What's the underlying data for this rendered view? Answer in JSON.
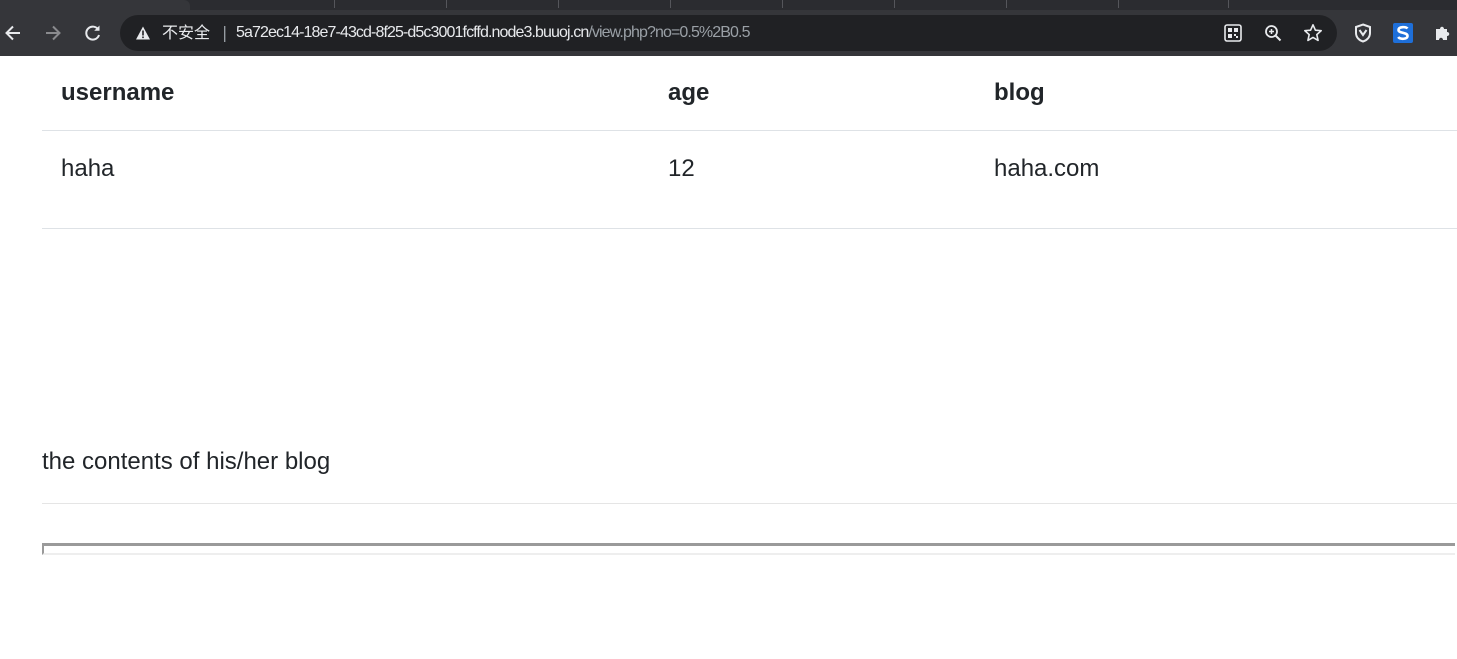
{
  "browser": {
    "address_bar": {
      "security_label": "不安全",
      "separator": "|",
      "url_host": "5a72ec14-18e7-43cd-8f25-d5c3001fcffd.node3.buuoj.cn",
      "url_path": "/view.php?no=0.5%2B0.5"
    },
    "icons": {
      "back": "back-arrow-icon",
      "forward": "forward-arrow-icon",
      "reload": "reload-icon",
      "warning": "warning-triangle-icon",
      "qr": "qr-code-icon",
      "zoom": "zoom-icon",
      "bookmark": "star-icon",
      "extension_shield": "shield-extension-icon",
      "extension_s": "s-extension-icon",
      "extensions": "puzzle-icon"
    }
  },
  "table": {
    "headers": [
      "username",
      "age",
      "blog"
    ],
    "rows": [
      [
        "haha",
        "12",
        "haha.com"
      ]
    ]
  },
  "blog_section": {
    "heading": "the contents of his/her blog"
  },
  "colors": {
    "toolbar": "#35363a",
    "omnibox": "#202124",
    "text": "#212529",
    "table_border": "#dee2e6",
    "extension_s": "#1e6fd9"
  }
}
